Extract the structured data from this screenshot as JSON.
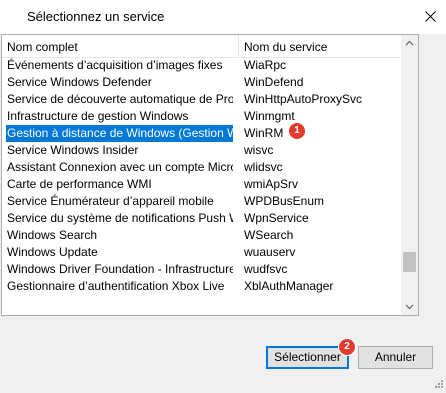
{
  "dialog": {
    "title": "Sélectionnez un service"
  },
  "list": {
    "columns": [
      "Nom complet",
      "Nom du service"
    ],
    "rows": [
      {
        "name": "Événements d’acquisition d’images fixes",
        "service": "WiaRpc"
      },
      {
        "name": "Service Windows Defender",
        "service": "WinDefend"
      },
      {
        "name": "Service de découverte automatique de Proxy ...",
        "service": "WinHttpAutoProxySvc"
      },
      {
        "name": "Infrastructure de gestion Windows",
        "service": "Winmgmt"
      },
      {
        "name": "Gestion à distance de Windows (Gestion WSM)",
        "service": "WinRM",
        "selected": true
      },
      {
        "name": "Service Windows Insider",
        "service": "wisvc"
      },
      {
        "name": "Assistant Connexion avec un compte Microsoft",
        "service": "wlidsvc"
      },
      {
        "name": "Carte de performance WMI",
        "service": "wmiApSrv"
      },
      {
        "name": "Service Énumérateur d’appareil mobile",
        "service": "WPDBusEnum"
      },
      {
        "name": "Service du système de notifications Push Win...",
        "service": "WpnService"
      },
      {
        "name": "Windows Search",
        "service": "WSearch"
      },
      {
        "name": "Windows Update",
        "service": "wuauserv"
      },
      {
        "name": "Windows Driver Foundation - Infrastructure de ...",
        "service": "wudfsvc"
      },
      {
        "name": "Gestionnaire d’authentification Xbox Live",
        "service": "XblAuthManager"
      }
    ]
  },
  "badges": [
    "1",
    "2"
  ],
  "buttons": {
    "select": "Sélectionner",
    "cancel": "Annuler"
  },
  "colors": {
    "selection": "#0078d7",
    "badge": "#e23b2e",
    "accent_border": "#0078d7"
  }
}
